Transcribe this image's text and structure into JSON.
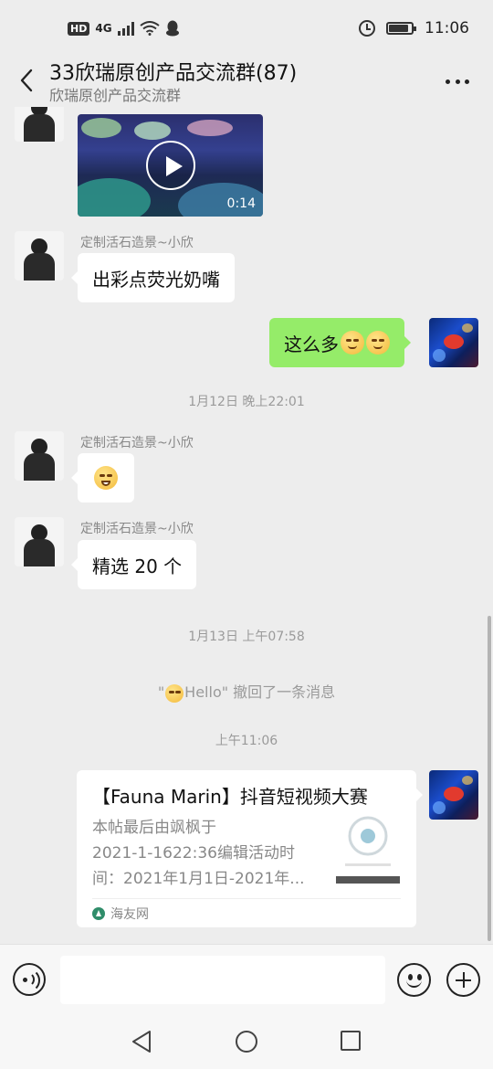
{
  "status_bar": {
    "hd": "HD",
    "network": "4G",
    "time": "11:06",
    "battery_level": 0.8
  },
  "header": {
    "title": "33欣瑞原创产品交流群(87)",
    "subtitle": "欣瑞原创产品交流群",
    "back_icon": "chevron-left-icon",
    "more_icon": "more-icon"
  },
  "messages": [
    {
      "type": "video",
      "direction": "in",
      "duration": "0:14"
    },
    {
      "type": "text",
      "direction": "in",
      "sender": "定制活石造景~小欣",
      "text": "出彩点荧光奶嘴"
    },
    {
      "type": "text",
      "direction": "out",
      "text": "这么多",
      "emoji_count": 2
    },
    {
      "type": "time",
      "text": "1月12日 晚上22:01"
    },
    {
      "type": "emoji",
      "direction": "in",
      "sender": "定制活石造景~小欣"
    },
    {
      "type": "text",
      "direction": "in",
      "sender": "定制活石造景~小欣",
      "text": "精选 20 个"
    },
    {
      "type": "time",
      "text": "1月13日 上午07:58"
    },
    {
      "type": "recall",
      "before": "\"",
      "text": "Hello\" 撤回了一条消息"
    },
    {
      "type": "time",
      "text": "上午11:06"
    },
    {
      "type": "link",
      "direction": "out",
      "title": "【Fauna Marin】抖音短视频大赛",
      "desc_lines": [
        "本帖最后由飒枫于",
        "2021-1-1622:36编辑活动时",
        "间：2021年1月1日-2021年..."
      ],
      "source": "海友网"
    }
  ],
  "input_bar": {
    "placeholder": "",
    "voice_icon": "voice-icon",
    "emoji_icon": "emoji-icon",
    "plus_icon": "plus-icon"
  },
  "colors": {
    "background": "#ededed",
    "outgoing_bubble": "#95ec69",
    "incoming_bubble": "#ffffff"
  }
}
